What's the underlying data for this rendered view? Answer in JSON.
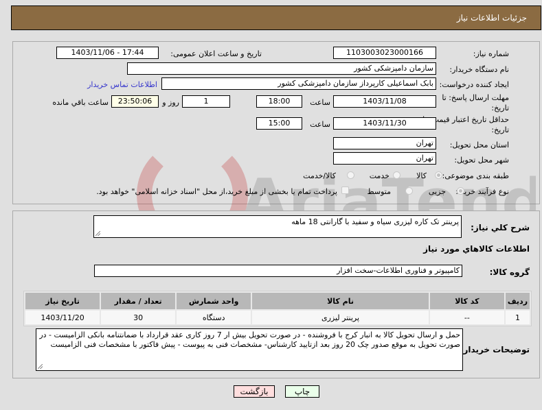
{
  "header": {
    "title": "جزئیات اطلاعات نیاز"
  },
  "form": {
    "need_number": {
      "label": "شماره نیاز:",
      "value": "1103003023000166"
    },
    "announce": {
      "label": "تاریخ و ساعت اعلان عمومی:",
      "value": "1403/11/06 - 17:44"
    },
    "buyer_org": {
      "label": "نام دستگاه خریدار:",
      "value": "سازمان دامپزشکی کشور"
    },
    "creator": {
      "label": "ایجاد کننده درخواست:",
      "value": "بابک اسماعیلی کارپرداز سازمان دامپزشکی کشور",
      "contact_link": "اطلاعات تماس خریدار"
    },
    "response_deadline": {
      "label_line1": "مهلت ارسال پاسخ: تا",
      "label_line2": "تاریخ:",
      "date": "1403/11/08",
      "time_label": "ساعت",
      "time": "18:00",
      "days": "1",
      "days_label": "روز و",
      "remaining": "23:50:06",
      "remaining_label": "ساعت باقي مانده"
    },
    "price_validity": {
      "label_line1": "حداقل تاریخ اعتبار قیمت: تا",
      "label_line2": "تاریخ:",
      "date": "1403/11/30",
      "time_label": "ساعت",
      "time": "15:00"
    },
    "province": {
      "label": "استان محل تحویل:",
      "value": "تهران"
    },
    "city": {
      "label": "شهر محل تحویل:",
      "value": "تهران"
    },
    "category": {
      "label": "طبقه بندی موضوعی:",
      "options": [
        {
          "label": "کالا",
          "checked": true
        },
        {
          "label": "خدمت",
          "checked": false
        },
        {
          "label": "کالا/خدمت",
          "checked": false
        }
      ]
    },
    "process": {
      "label": "نوع فرآیند خرید :",
      "options": [
        {
          "label": "جزیی",
          "checked": true
        },
        {
          "label": "متوسط",
          "checked": false
        }
      ],
      "treasury_checkbox": {
        "checked": false,
        "label": "پرداخت تمام یا بخشی از مبلغ خرید،از محل \"اسناد خزانه اسلامی\" خواهد بود."
      }
    }
  },
  "details": {
    "general_desc": {
      "label": "شرح کلي نياز:",
      "value": "پرینتر تک کاره لیزری سیاه و سفید با گارانتی 18 ماهه"
    },
    "goods_info_title": "اطلاعات کالاهاي مورد نياز",
    "goods_group": {
      "label": "گروه کالا:",
      "value": "کامپیوتر و فناوری اطلاعات-سخت افزار"
    },
    "table": {
      "headers": [
        "ردیف",
        "کد کالا",
        "نام کالا",
        "واحد شمارش",
        "تعداد / مقدار",
        "تاریخ نیاز"
      ],
      "rows": [
        [
          "1",
          "--",
          "پرینتر لیزری",
          "دستگاه",
          "30",
          "1403/11/20"
        ]
      ]
    },
    "buyer_notes": {
      "label": "توضیحات خریدار:",
      "value": "حمل و ارسال  تحویل کالا به انبار کرج  با فروشنده - در صورت تحویل بیش ار 7 روز کاری عقد قرارداد با ضمانتنامه بانکی الزامیست - در صورت تحویل به موقع صدور چک 20 روز بعد ازتایید کارشناس- مشخصات فنی به پیوست -  پیش فاکتور با مشخصات فنی الزامیست"
    }
  },
  "buttons": {
    "print": "چاپ",
    "back": "بازگشت"
  },
  "watermark": {
    "text": "AriaTender.neT"
  },
  "colors": {
    "header_bg": "#8b6b42",
    "print_bg": "#eaffea",
    "back_bg": "#ffdede",
    "link": "#3333cc"
  }
}
